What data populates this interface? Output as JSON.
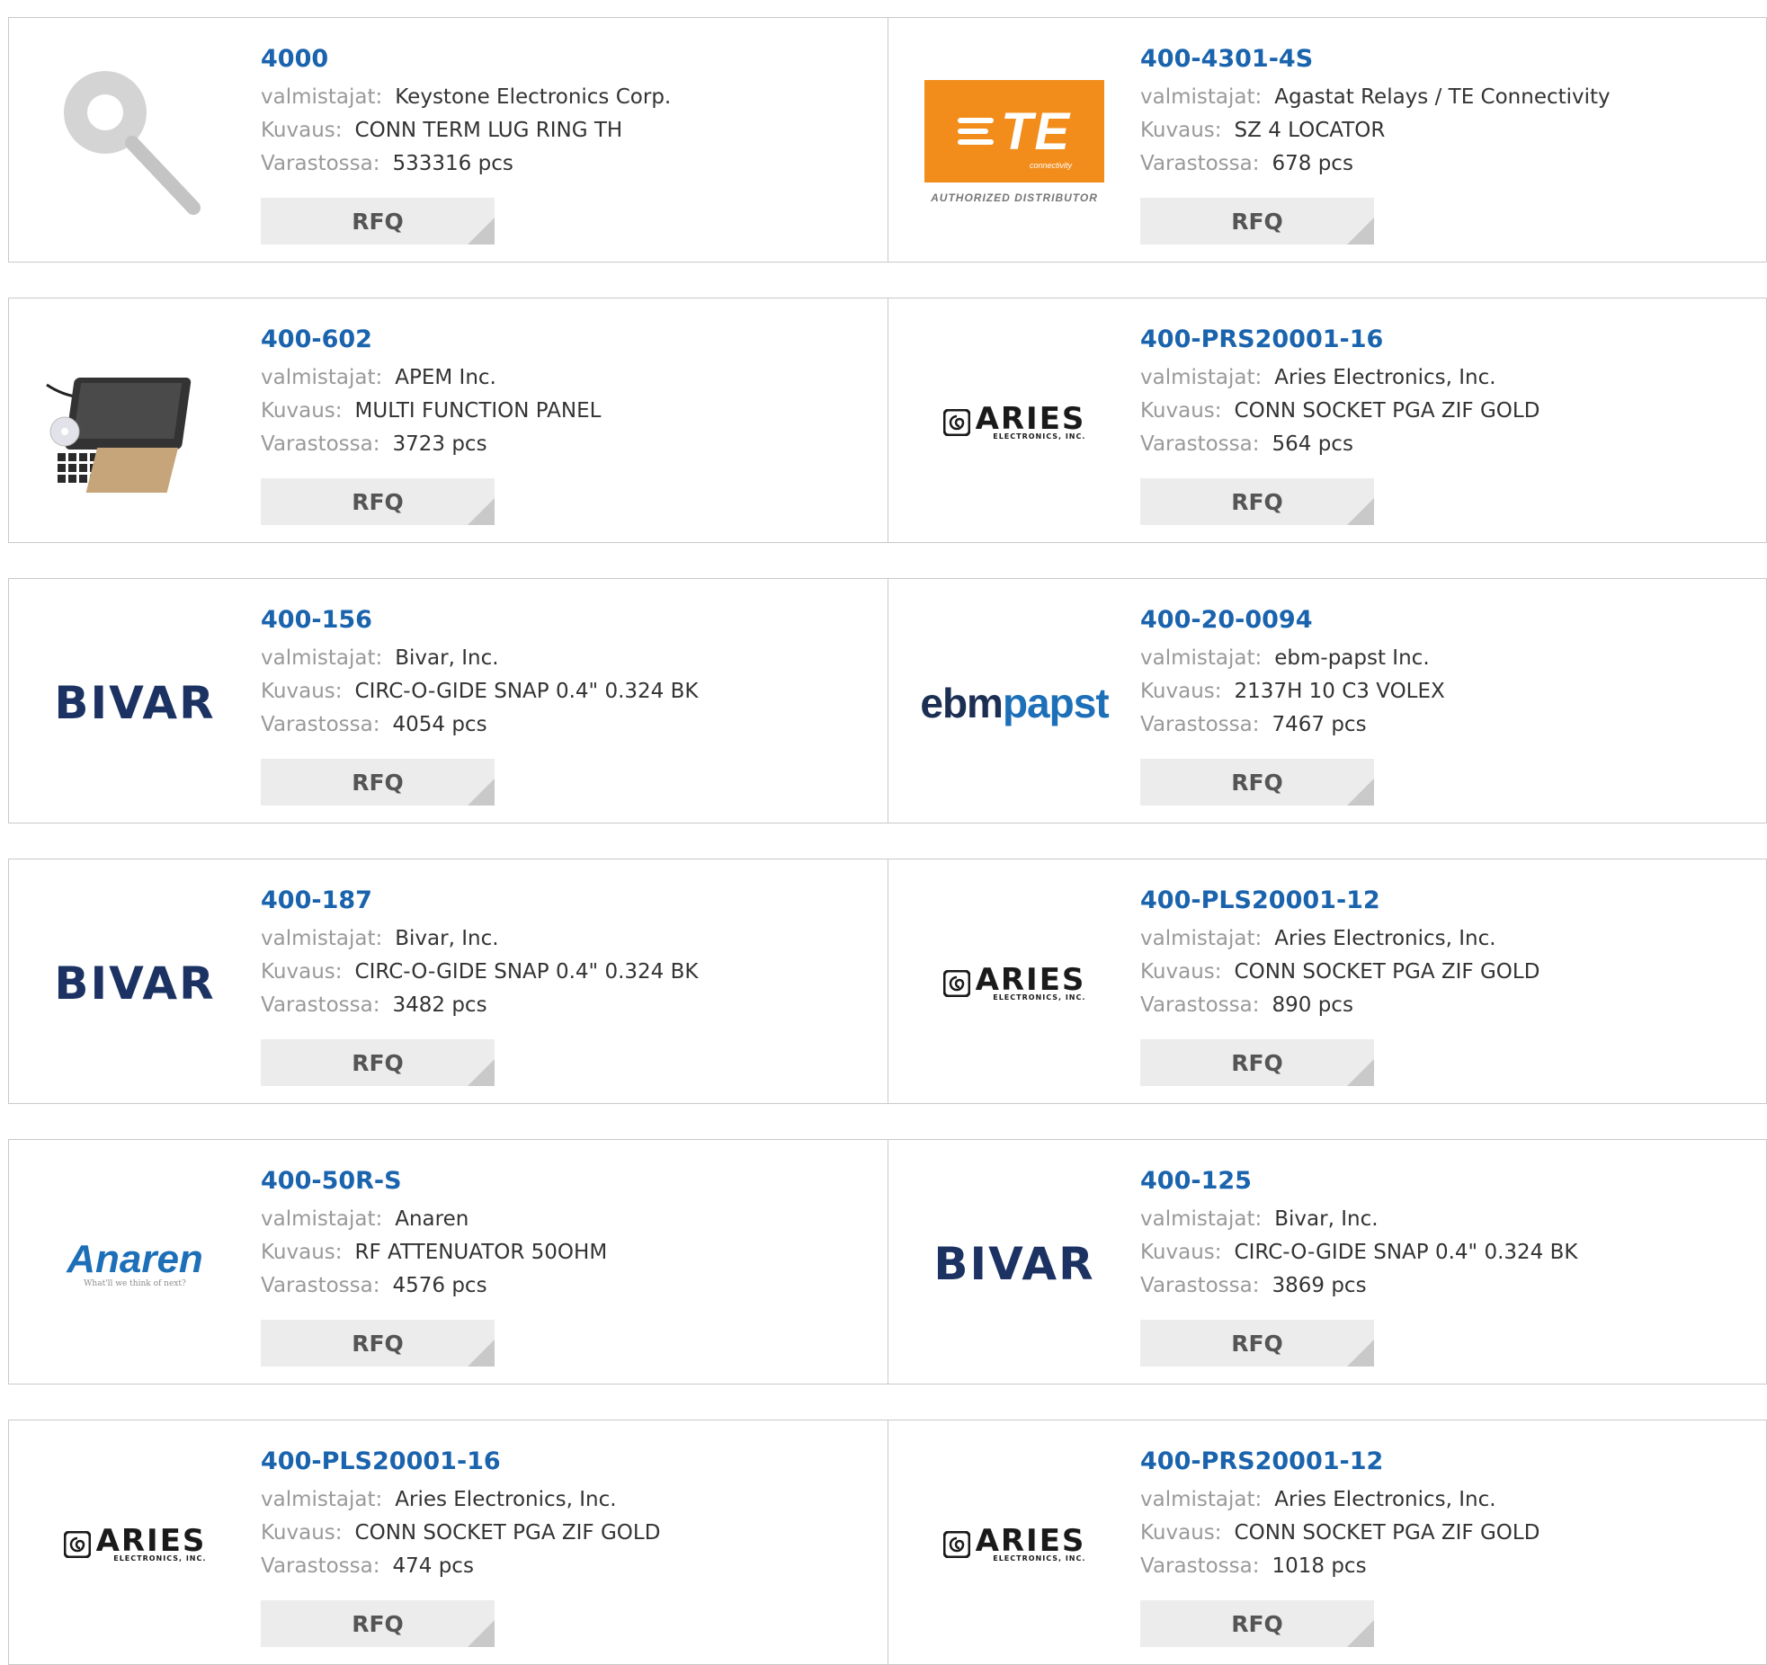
{
  "labels": {
    "manufacturer": "valmistajat:",
    "description": "Kuvaus:",
    "stock": "Varastossa:",
    "rfq": "RFQ"
  },
  "products": [
    {
      "part": "4000",
      "manufacturer": "Keystone Electronics Corp.",
      "description": "CONN TERM LUG RING TH",
      "stock": "533316 pcs",
      "image": "ring-lug-photo"
    },
    {
      "part": "400-4301-4S",
      "manufacturer": "Agastat Relays / TE Connectivity",
      "description": "SZ 4 LOCATOR",
      "stock": "678 pcs",
      "image": "te-connectivity-logo"
    },
    {
      "part": "400-602",
      "manufacturer": "APEM Inc.",
      "description": "MULTI FUNCTION PANEL",
      "stock": "3723 pcs",
      "image": "panel-kit-photo"
    },
    {
      "part": "400-PRS20001-16",
      "manufacturer": "Aries Electronics, Inc.",
      "description": "CONN SOCKET PGA ZIF GOLD",
      "stock": "564 pcs",
      "image": "aries-logo"
    },
    {
      "part": "400-156",
      "manufacturer": "Bivar, Inc.",
      "description": "CIRC-O-GIDE SNAP 0.4\" 0.324 BK",
      "stock": "4054 pcs",
      "image": "bivar-logo"
    },
    {
      "part": "400-20-0094",
      "manufacturer": "ebm-papst Inc.",
      "description": "2137H 10 C3 VOLEX",
      "stock": "7467 pcs",
      "image": "ebmpapst-logo"
    },
    {
      "part": "400-187",
      "manufacturer": "Bivar, Inc.",
      "description": "CIRC-O-GIDE SNAP 0.4\" 0.324 BK",
      "stock": "3482 pcs",
      "image": "bivar-logo"
    },
    {
      "part": "400-PLS20001-12",
      "manufacturer": "Aries Electronics, Inc.",
      "description": "CONN SOCKET PGA ZIF GOLD",
      "stock": "890 pcs",
      "image": "aries-logo"
    },
    {
      "part": "400-50R-S",
      "manufacturer": "Anaren",
      "description": "RF ATTENUATOR 50OHM",
      "stock": "4576 pcs",
      "image": "anaren-logo"
    },
    {
      "part": "400-125",
      "manufacturer": "Bivar, Inc.",
      "description": "CIRC-O-GIDE SNAP 0.4\" 0.324 BK",
      "stock": "3869 pcs",
      "image": "bivar-logo"
    },
    {
      "part": "400-PLS20001-16",
      "manufacturer": "Aries Electronics, Inc.",
      "description": "CONN SOCKET PGA ZIF GOLD",
      "stock": "474 pcs",
      "image": "aries-logo"
    },
    {
      "part": "400-PRS20001-12",
      "manufacturer": "Aries Electronics, Inc.",
      "description": "CONN SOCKET PGA ZIF GOLD",
      "stock": "1018 pcs",
      "image": "aries-logo"
    }
  ],
  "logos": {
    "te": {
      "letters": "TE",
      "sub": "connectivity",
      "auth": "AUTHORIZED DISTRIBUTOR"
    },
    "aries": {
      "big": "ARIES",
      "small": "ELECTRONICS, INC."
    },
    "bivar": {
      "word": "BIVAR"
    },
    "ebm": {
      "e": "ebm",
      "p": "papst"
    },
    "anaren": {
      "word": "Anaren",
      "tagline": "What'll we think of next?"
    }
  },
  "colors": {
    "link": "#1a63ad",
    "label": "#999999",
    "te_orange": "#f28d1c",
    "bivar_navy": "#1c3262",
    "papst_blue": "#1d6fb8"
  }
}
